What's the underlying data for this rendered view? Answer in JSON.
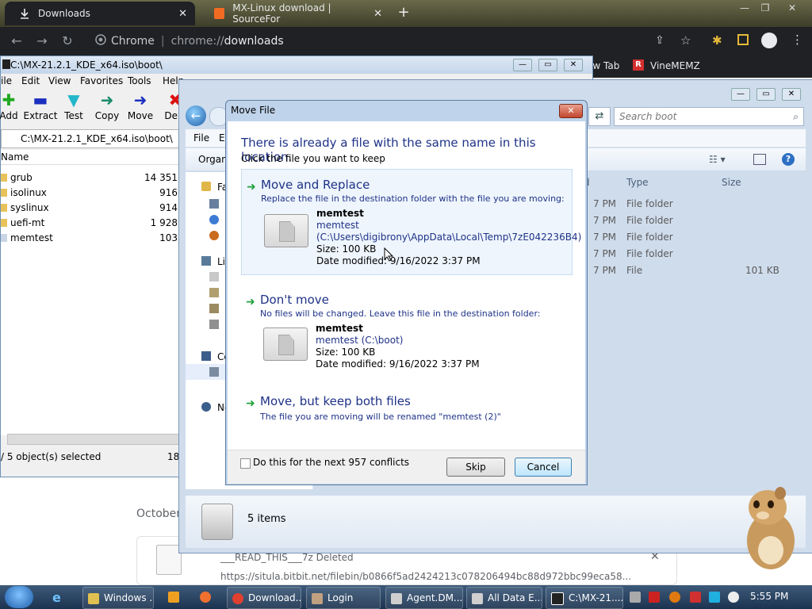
{
  "chrome": {
    "tabs": [
      {
        "label": "Downloads",
        "active": true
      },
      {
        "label": "MX-Linux download | SourceFor",
        "active": false
      }
    ],
    "omnibox_chip": "Chrome",
    "omnibox_url_scheme": "chrome://",
    "omnibox_url_rest": "downloads",
    "bookmarks": [
      "ew Tab",
      "VineMEMZ"
    ]
  },
  "sevenzip": {
    "title": "C:\\MX-21.2.1_KDE_x64.iso\\boot\\",
    "menu": [
      "ile",
      "Edit",
      "View",
      "Favorites",
      "Tools",
      "Help"
    ],
    "toolbar": [
      "Add",
      "Extract",
      "Test",
      "Copy",
      "Move",
      "Dele"
    ],
    "path": "C:\\MX-21.2.1_KDE_x64.iso\\boot\\",
    "column_name": "Name",
    "items": [
      {
        "name": "grub",
        "size": "14 351"
      },
      {
        "name": "isolinux",
        "size": "916"
      },
      {
        "name": "syslinux",
        "size": "914"
      },
      {
        "name": "uefi-mt",
        "size": "1 928"
      },
      {
        "name": "memtest",
        "size": "103"
      }
    ],
    "status": "/ 5 object(s) selected",
    "status_size": "18"
  },
  "explorer": {
    "search_placeholder": "Search boot",
    "menu": [
      "File",
      "E"
    ],
    "organize": "Organ",
    "nav_labels": [
      "Fa",
      "Lil",
      "Co",
      "Ne"
    ],
    "columns": {
      "type": "Type",
      "size": "Size",
      "date_frag": "d"
    },
    "rows": [
      {
        "date": "7 PM",
        "type": "File folder",
        "size": ""
      },
      {
        "date": "7 PM",
        "type": "File folder",
        "size": ""
      },
      {
        "date": "7 PM",
        "type": "File folder",
        "size": ""
      },
      {
        "date": "7 PM",
        "type": "File folder",
        "size": ""
      },
      {
        "date": "7 PM",
        "type": "File",
        "size": "101 KB"
      }
    ],
    "details": "5 items"
  },
  "dialog": {
    "title": "Move File",
    "heading": "There is already a file with the same name in this location.",
    "subheading": "Click the file you want to keep",
    "option1": {
      "title": "Move and Replace",
      "desc": "Replace the file in the destination folder with the file you are moving:",
      "file_name": "memtest",
      "file_line": "memtest",
      "file_path": "(C:\\Users\\digibrony\\AppData\\Local\\Temp\\7zE042236B4)",
      "size": "Size: 100 KB",
      "modified": "Date modified: 9/16/2022 3:37 PM"
    },
    "option2": {
      "title": "Don't move",
      "desc": "No files will be changed. Leave this file in the destination folder:",
      "file_name": "memtest",
      "file_line": "memtest (C:\\boot)",
      "size": "Size: 100 KB",
      "modified": "Date modified: 9/16/2022 3:37 PM"
    },
    "option3": {
      "title": "Move, but keep both files",
      "desc": "The file you are moving will be renamed \"memtest (2)\""
    },
    "checkbox_label": "Do this for the next 957 conflicts",
    "skip": "Skip",
    "cancel": "Cancel"
  },
  "downloads_page": {
    "date": "October",
    "file": "___READ_THIS___7z   Deleted",
    "url": "https://situla.bitbit.net/filebin/b0866f5ad2424213c078206494bc88d972bbc99eca58..."
  },
  "taskbar": {
    "tasks": [
      "Windows ...",
      "Download...",
      "Login",
      "Agent.DM...",
      "All Data E...",
      "C:\\MX-21...."
    ],
    "clock": "5:55 PM"
  }
}
